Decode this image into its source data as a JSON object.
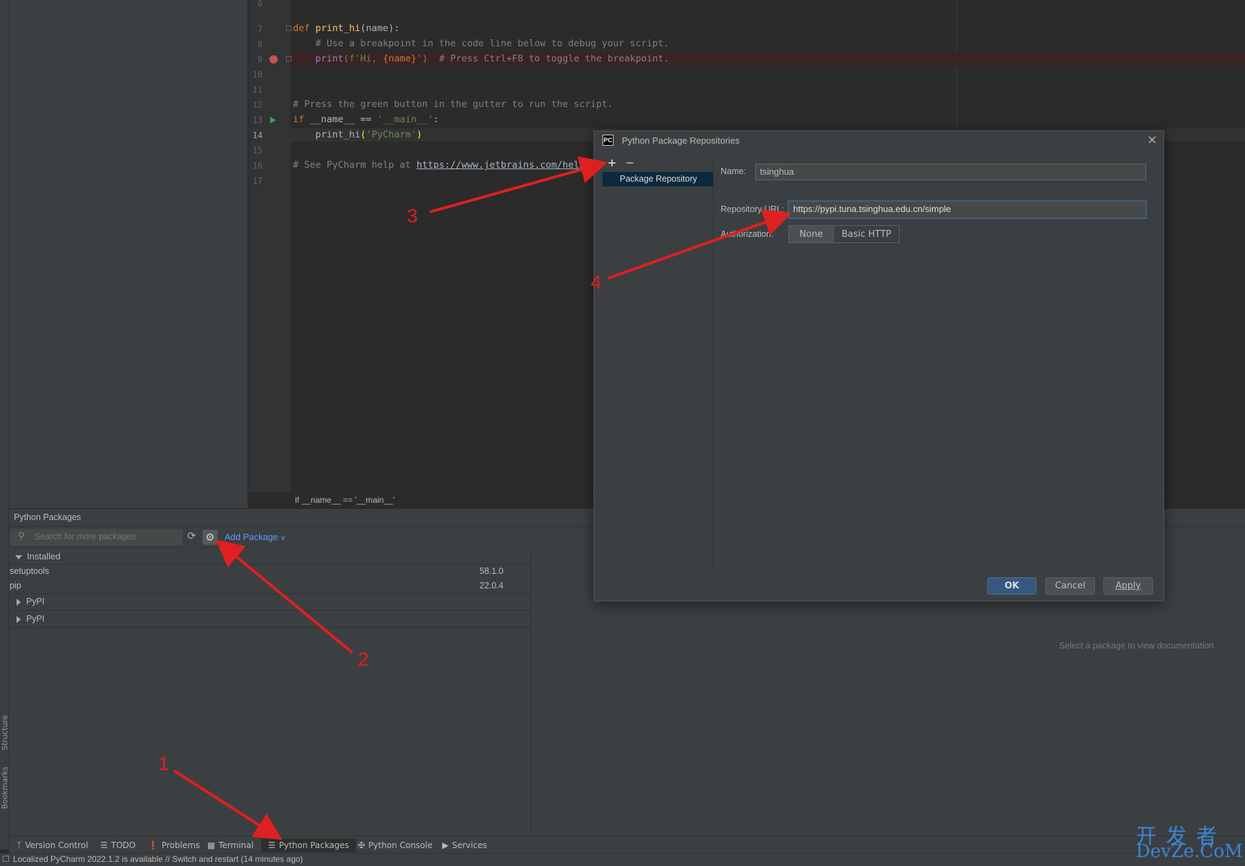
{
  "editor": {
    "line_numbers": [
      "6",
      "7",
      "8",
      "9",
      "10",
      "11",
      "12",
      "13",
      "14",
      "15",
      "16",
      "17"
    ],
    "lines": {
      "l7_kw": "def ",
      "l7_fn": "print_hi",
      "l7_rest": "(name):",
      "l8": "    # Use a breakpoint in the code line below to debug your script.",
      "l9_a": "    print",
      "l9_b": "(f'Hi, ",
      "l9_c": "{name}",
      "l9_d": "')",
      "l9_e": "  # Press Ctrl+F8 to toggle the breakpoint.",
      "l12": "# Press the green button in the gutter to run the script.",
      "l13_kw": "if ",
      "l13_a": "__name__ == ",
      "l13_str": "'__main__'",
      "l13_b": ":",
      "l14_a": "    print_hi",
      "l14_b": "(",
      "l14_str": "'PyCharm'",
      "l14_c": ")",
      "l16_a": "# See PyCharm help at ",
      "l16_url": "https://www.jetbrains.com/help/py"
    },
    "breadcrumb": "if __name__ == '__main__'"
  },
  "packages_panel": {
    "title": "Python Packages",
    "search_placeholder": "Search for more packages",
    "add_package_label": "Add Package",
    "installed_label": "Installed",
    "installed": [
      {
        "name": "setuptools",
        "version": "58.1.0"
      },
      {
        "name": "pip",
        "version": "22.0.4"
      }
    ],
    "repos": [
      "PyPI",
      "PyPI"
    ],
    "doc_placeholder": "Select a package to view documentation"
  },
  "dialog": {
    "title": "Python Package Repositories",
    "add_symbol": "+",
    "remove_symbol": "−",
    "list_item": "Package Repository",
    "name_label": "Name:",
    "name_value": "tsinghua",
    "url_label": "Repository URL:",
    "url_value": "https://pypi.tuna.tsinghua.edu.cn/simple",
    "auth_label": "Authorization:",
    "auth_options": [
      "None",
      "Basic HTTP"
    ],
    "ok": "OK",
    "cancel": "Cancel",
    "apply": "Apply"
  },
  "tool_tabs": [
    {
      "label": "Version Control",
      "icon": "branch-icon"
    },
    {
      "label": "TODO",
      "icon": "list-icon"
    },
    {
      "label": "Problems",
      "icon": "warning-icon"
    },
    {
      "label": "Terminal",
      "icon": "terminal-icon"
    },
    {
      "label": "Python Packages",
      "icon": "layers-icon"
    },
    {
      "label": "Python Console",
      "icon": "python-icon"
    },
    {
      "label": "Services",
      "icon": "play-circle-icon"
    }
  ],
  "side_tabs": [
    "Structure",
    "Bookmarks"
  ],
  "status": "Localized PyCharm 2022.1.2 is available // Switch and restart (14 minutes ago)",
  "annotations": [
    "1",
    "2",
    "3",
    "4"
  ],
  "watermark": {
    "top": "开 发 者",
    "bottom": "DevZe.CoM"
  },
  "colors": {
    "annotation": "#e02020",
    "accent": "#365880",
    "focus": "#3d6185"
  }
}
